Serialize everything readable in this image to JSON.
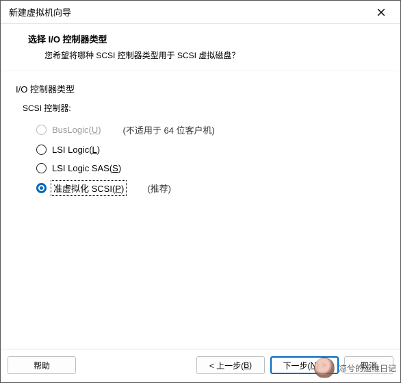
{
  "titlebar": {
    "title": "新建虚拟机向导"
  },
  "header": {
    "title": "选择 I/O 控制器类型",
    "subtitle": "您希望将哪种 SCSI 控制器类型用于 SCSI 虚拟磁盘？"
  },
  "section": {
    "label": "I/O 控制器类型",
    "sub_label": "SCSI 控制器:"
  },
  "options": {
    "buslogic": {
      "label": "BusLogic(",
      "accel": "U",
      "after": ")",
      "hint": "(不适用于 64 位客户机)"
    },
    "lsilogic": {
      "label": "LSI Logic(",
      "accel": "L",
      "after": ")"
    },
    "lsisas": {
      "label": "LSI Logic SAS(",
      "accel": "S",
      "after": ")"
    },
    "paravirt": {
      "label": "准虚拟化 SCSI(",
      "accel": "P",
      "after": ")",
      "hint": "(推荐)"
    }
  },
  "footer": {
    "help": "帮助",
    "back_pre": "< 上一步(",
    "back_accel": "B",
    "back_post": ")",
    "next_pre": "下一步(",
    "next_accel": "N",
    "next_post": ") >",
    "cancel": "取消"
  },
  "watermark": {
    "text": "凉兮的运维日记"
  }
}
